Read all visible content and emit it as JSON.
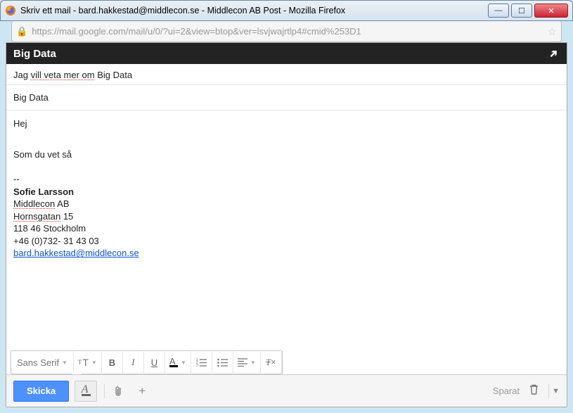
{
  "window": {
    "title": "Skriv ett mail - bard.hakkestad@middlecon.se - Middlecon AB Post - Mozilla Firefox",
    "url": "https://mail.google.com/mail/u/0/?ui=2&view=btop&ver=lsvjwajrtlp4#cmid%253D1"
  },
  "compose": {
    "header_title": "Big Data",
    "recipients_line_prefix": "Jag ",
    "recipients_line_spelled": "vill veta mer om",
    "recipients_line_suffix": " Big Data",
    "subject": "Big Data",
    "body": {
      "greeting": "Hej",
      "line2": "Som du vet så"
    },
    "signature": {
      "divider": "--",
      "name": "Sofie Larsson",
      "company_spelled": "Middlecon",
      "company_suffix": " AB",
      "street_spelled": "Hornsgatan",
      "street_suffix": " 15",
      "postal": "118 46 Stockholm",
      "phone": "+46 (0)732- 31 43 03",
      "email": "bard.hakkestad@middlecon.se"
    }
  },
  "toolbar": {
    "font_label": "Sans Serif"
  },
  "actions": {
    "send": "Skicka",
    "saved": "Sparat"
  }
}
